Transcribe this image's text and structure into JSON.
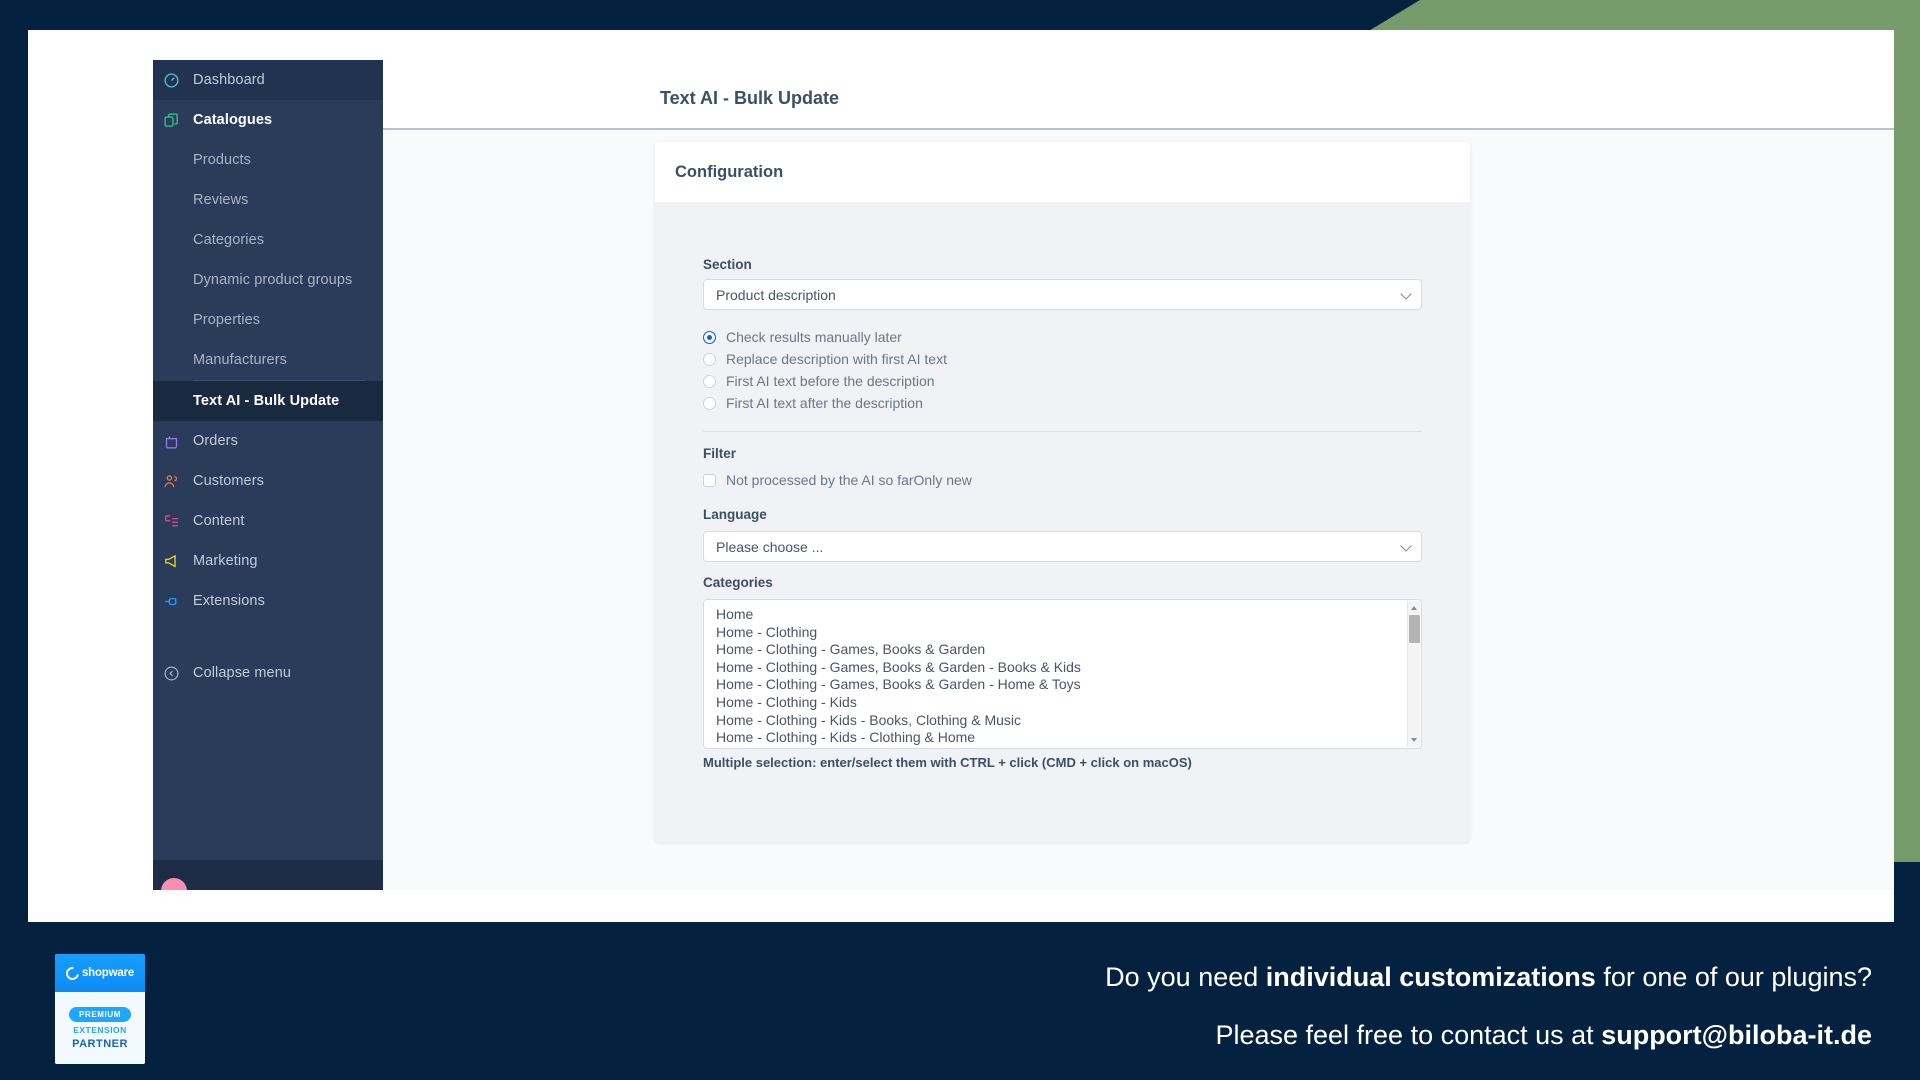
{
  "theme": {
    "navy": "#04223f",
    "green_accent": "#769b6b",
    "sidebar_bg": "#2a3c5a",
    "active_blue": "#0a64e0"
  },
  "header": {
    "page_title": "Text AI - Bulk Update"
  },
  "sidebar": {
    "items": [
      {
        "label": "Dashboard",
        "icon": "dashboard-gauge-icon",
        "icon_color": "#4fc3dd",
        "type": "main",
        "state": "hover"
      },
      {
        "label": "Catalogues",
        "icon": "catalogues-copy-icon",
        "icon_color": "#36c88a",
        "type": "main",
        "state": "expanded"
      },
      {
        "label": "Products",
        "icon": "",
        "type": "sub",
        "state": "normal"
      },
      {
        "label": "Reviews",
        "icon": "",
        "type": "sub",
        "state": "normal"
      },
      {
        "label": "Categories",
        "icon": "",
        "type": "sub",
        "state": "normal"
      },
      {
        "label": "Dynamic product groups",
        "icon": "",
        "type": "sub",
        "state": "normal"
      },
      {
        "label": "Properties",
        "icon": "",
        "type": "sub",
        "state": "normal"
      },
      {
        "label": "Manufacturers",
        "icon": "",
        "type": "sub",
        "state": "normal"
      },
      {
        "label": "Text AI - Bulk Update",
        "icon": "",
        "type": "sub",
        "state": "selected"
      },
      {
        "label": "Orders",
        "icon": "orders-bag-icon",
        "icon_color": "#9b7cf0",
        "type": "main",
        "state": "normal"
      },
      {
        "label": "Customers",
        "icon": "customers-people-icon",
        "icon_color": "#ee7744",
        "type": "main",
        "state": "normal"
      },
      {
        "label": "Content",
        "icon": "content-layout-icon",
        "icon_color": "#ec4899",
        "type": "main",
        "state": "normal"
      },
      {
        "label": "Marketing",
        "icon": "marketing-megaphone-icon",
        "icon_color": "#e8e028",
        "type": "main",
        "state": "normal"
      },
      {
        "label": "Extensions",
        "icon": "extensions-plug-icon",
        "icon_color": "#189eff",
        "type": "main",
        "state": "normal"
      }
    ],
    "collapse": {
      "label": "Collapse menu",
      "icon": "collapse-chevron-left-circle-icon"
    }
  },
  "card": {
    "title": "Configuration",
    "section": {
      "label": "Section",
      "value": "Product description",
      "chevron_icon": "chevron-down-icon"
    },
    "mode_options": [
      {
        "label": "Check results manually later",
        "selected": true
      },
      {
        "label": "Replace description with first AI text",
        "selected": false
      },
      {
        "label": "First AI text before the description",
        "selected": false
      },
      {
        "label": "First AI text after the description",
        "selected": false
      }
    ],
    "filter": {
      "label": "Filter",
      "checkbox_label": "Not processed by the AI so farOnly new",
      "checked": false
    },
    "language": {
      "label": "Language",
      "value": "Please choose ...",
      "chevron_icon": "chevron-down-icon"
    },
    "categories": {
      "label": "Categories",
      "items": [
        "Home",
        "Home - Clothing",
        "Home - Clothing - Games, Books & Garden",
        "Home - Clothing - Games, Books & Garden - Books & Kids",
        "Home - Clothing - Games, Books & Garden - Home & Toys",
        "Home - Clothing - Kids",
        "Home - Clothing - Kids - Books, Clothing & Music",
        "Home - Clothing - Kids - Clothing & Home"
      ],
      "hint": "Multiple selection: enter/select them with CTRL + click (CMD + click on macOS)"
    }
  },
  "banner": {
    "line1_pre": "Do you need ",
    "line1_bold": "individual customizations",
    "line1_post": " for one of our plugins?",
    "line2_pre": "Please feel free to contact us at ",
    "line2_bold": "support@biloba-it.de",
    "badge": {
      "brand": "shopware",
      "pill": "PREMIUM",
      "line1": "EXTENSION",
      "line2": "PARTNER"
    }
  }
}
